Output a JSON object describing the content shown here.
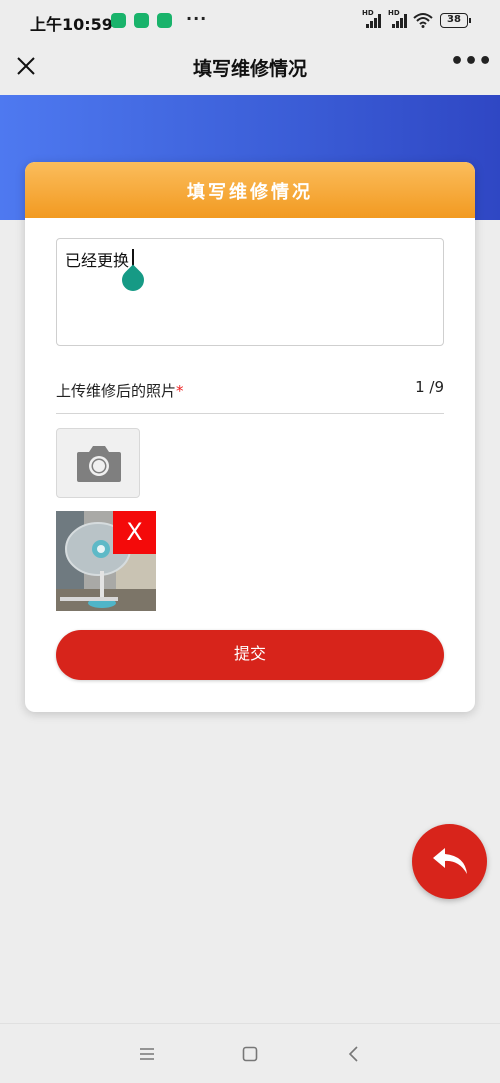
{
  "status_bar": {
    "time": "上午10:59",
    "more": "···",
    "battery": "38"
  },
  "nav": {
    "title": "填写维修情况",
    "more": "•••"
  },
  "card": {
    "title": "填写维修情况",
    "description_value": "已经更换",
    "upload_label": "上传维修后的照片",
    "required_mark": "*",
    "upload_count": "1 /9",
    "delete_label": "X",
    "submit_label": "提交"
  },
  "colors": {
    "banner": "#3c5fd8",
    "card_header": "#f29a21",
    "submit": "#d7241b",
    "fab": "#d8241b",
    "delete_badge": "#f40a0a"
  },
  "icons": {
    "close": "close-icon",
    "more": "more-icon",
    "camera": "camera-icon",
    "back": "back-arrow-icon"
  }
}
